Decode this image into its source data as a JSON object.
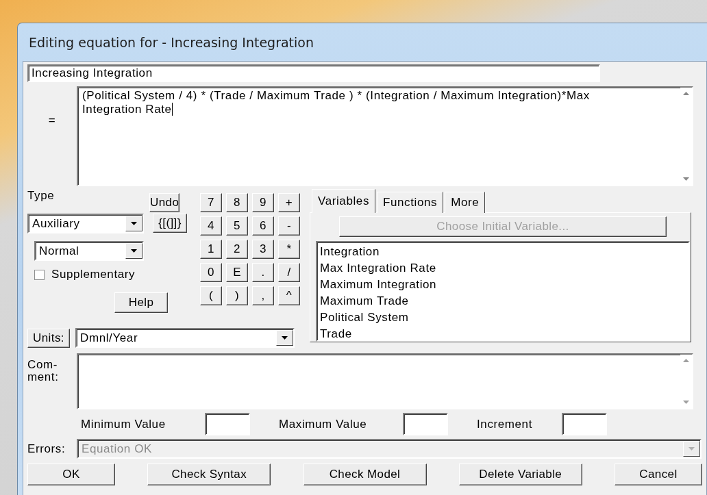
{
  "window": {
    "title": "Editing equation for - Increasing Integration"
  },
  "variable_name": {
    "value": "Increasing Integration"
  },
  "equation": {
    "label": "=",
    "value": "(Political System / 4) * (Trade / Maximum Trade ) * (Integration / Maximum Integration)*Max Integration Rate"
  },
  "type": {
    "label": "Type",
    "value": "Auxiliary"
  },
  "subtype": {
    "value": "Normal"
  },
  "supplementary": {
    "label": "Supplementary",
    "checked": false
  },
  "undo_button": "Undo",
  "brackets_button": "{[(]]}",
  "keypad": [
    "7",
    "8",
    "9",
    "+",
    "4",
    "5",
    "6",
    "-",
    "1",
    "2",
    "3",
    "*",
    "0",
    "E",
    ".",
    "/",
    "(",
    ")",
    ",",
    "^"
  ],
  "help_button": "Help",
  "units": {
    "button": "Units:",
    "value": "Dmnl/Year"
  },
  "tabs": [
    {
      "label": "Variables",
      "selected": true
    },
    {
      "label": "Functions",
      "selected": false
    },
    {
      "label": "More",
      "selected": false
    }
  ],
  "choose_button": {
    "label": "Choose Initial Variable...",
    "disabled": true
  },
  "variables": [
    "Integration",
    "Max Integration Rate",
    "Maximum Integration",
    "Maximum Trade",
    "Political System",
    "Trade"
  ],
  "comment": {
    "label": "Com-\nment:"
  },
  "limits": [
    {
      "label": "Minimum Value"
    },
    {
      "label": "Maximum Value"
    },
    {
      "label": "Increment"
    }
  ],
  "errors": {
    "label": "Errors:",
    "value": "Equation OK",
    "disabled": true
  },
  "buttons": [
    "OK",
    "Check Syntax",
    "Check Model",
    "Delete Variable",
    "Cancel"
  ]
}
